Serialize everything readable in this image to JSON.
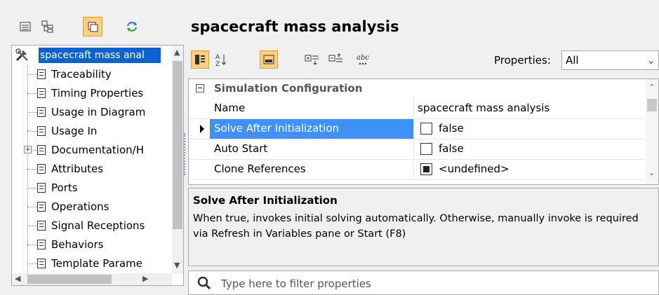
{
  "colors": {
    "selection": "#0a63d1",
    "row_selection": "#3f91f5",
    "active_button": "#ffcf82",
    "background": "#f0f0f0"
  },
  "left_toolbar": {
    "buttons": [
      {
        "icon": "list-view-icon"
      },
      {
        "icon": "tree-view-icon"
      },
      {
        "icon": "window-copy-icon",
        "active": true
      },
      {
        "icon": "refresh-icon"
      }
    ]
  },
  "tree": {
    "root": {
      "label": "spacecraft mass anal",
      "icon": "tools-icon"
    },
    "items": [
      {
        "label": "Traceability"
      },
      {
        "label": "Timing Properties"
      },
      {
        "label": "Usage in Diagram"
      },
      {
        "label": "Usage In"
      },
      {
        "label": "Documentation/H",
        "expandable": true
      },
      {
        "label": "Attributes"
      },
      {
        "label": "Ports"
      },
      {
        "label": "Operations"
      },
      {
        "label": "Signal Receptions"
      },
      {
        "label": "Behaviors"
      },
      {
        "label": "Template Parame"
      }
    ]
  },
  "header": {
    "title": "spacecraft mass analysis"
  },
  "prop_toolbar": {
    "properties_label": "Properties:",
    "properties_value": "All"
  },
  "grid": {
    "group": "Simulation Configuration",
    "rows": [
      {
        "name": "Name",
        "value": "spacecraft mass analysis",
        "type": "text"
      },
      {
        "name": "Solve After Initialization",
        "value": "false",
        "type": "check",
        "selected": true
      },
      {
        "name": "Auto Start",
        "value": "false",
        "type": "check"
      },
      {
        "name": "Clone References",
        "value": "<undefined>",
        "type": "check-filled"
      }
    ]
  },
  "description": {
    "title": "Solve After Initialization",
    "body": "When true, invokes initial solving automatically. Otherwise, manually invoke is required via Refresh in Variables pane or Start (F8)"
  },
  "filter": {
    "placeholder": "Type here to filter properties"
  }
}
